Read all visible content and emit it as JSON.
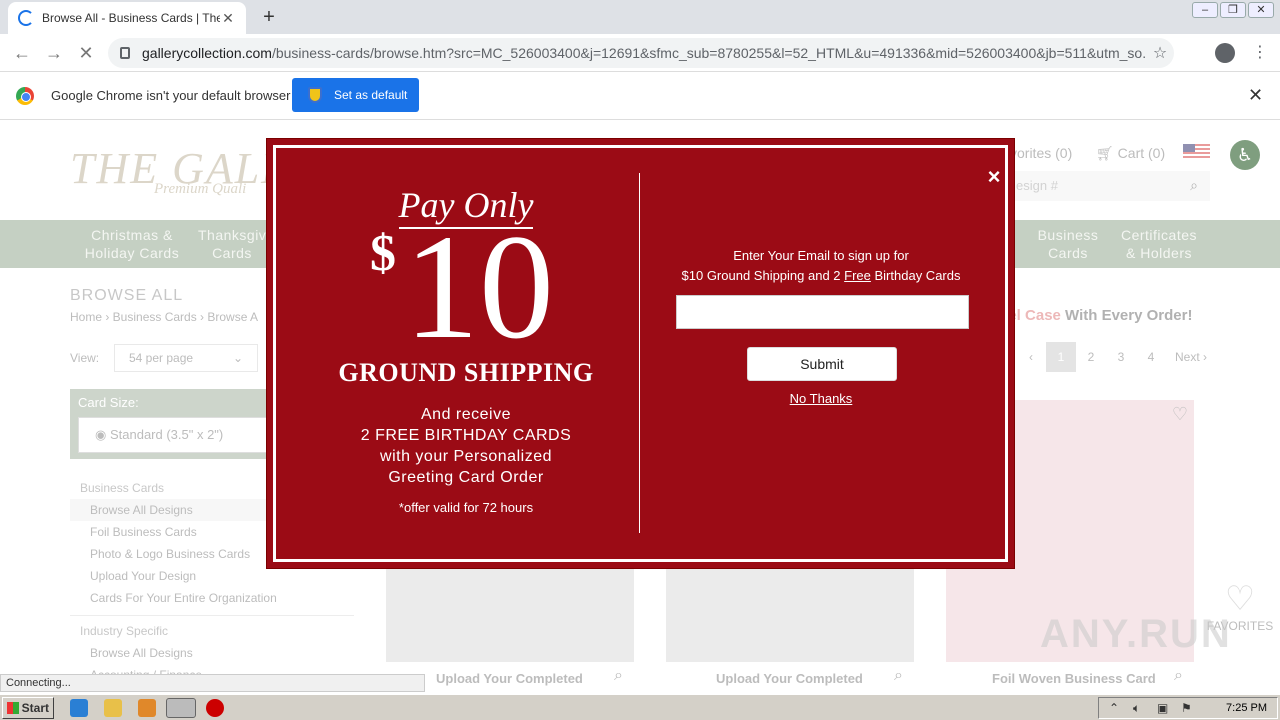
{
  "browser": {
    "tab_title": "Browse All - Business Cards | The Ga",
    "url_host": "gallerycollection.com",
    "url_path": "/business-cards/browse.htm?src=MC_526003400&j=12691&sfmc_sub=8780255&l=52_HTML&u=491336&mid=526003400&jb=511&utm_so...",
    "infobar_message": "Google Chrome isn't your default browser",
    "set_default_label": "Set as default"
  },
  "site": {
    "logo_text": "THE GALL",
    "logo_sub": "Premium Quali",
    "favorites": "vorites (0)",
    "cart": "Cart (0)",
    "search_placeholder": "esign #",
    "nav": [
      {
        "line1": "Christmas &",
        "line2": "Holiday Cards"
      },
      {
        "line1": "Thanksgiv",
        "line2": "Cards"
      },
      {
        "line1": "Business",
        "line2": "Cards"
      },
      {
        "line1": "Certificates",
        "line2": "& Holders"
      }
    ],
    "browse_heading": "BROWSE ALL",
    "breadcrumb": "Home › Business Cards › Browse A",
    "promo_red": "vel Case",
    "promo_rest": " With Every Order!",
    "view_label": "View:",
    "view_value": "54 per page",
    "pager": {
      "prev": "‹",
      "pages": [
        "1",
        "2",
        "3",
        "4"
      ],
      "next": "Next ›"
    },
    "card_size_label": "Card Size:",
    "card_size_value": "Standard (3.5\" x 2\")",
    "sidebar": {
      "group1": "Business Cards",
      "group1_items": [
        "Browse All Designs",
        "Foil Business Cards",
        "Photo & Logo Business Cards",
        "Upload Your Design",
        "Cards For Your Entire Organization"
      ],
      "group2": "Industry Specific",
      "group2_items": [
        "Browse All Designs",
        "Accounting / Finance"
      ]
    },
    "products": [
      {
        "name": "Upload Your Completed"
      },
      {
        "name": "Upload Your Completed"
      },
      {
        "name": "Foil Woven Business Card"
      }
    ],
    "favorites_badge": "FAVORITES"
  },
  "modal": {
    "pay_only": "Pay Only",
    "dollar_sign": "$",
    "amount": "10",
    "ground_shipping": "GROUND SHIPPING",
    "receive_line1": "And receive",
    "receive_line2": "2 FREE BIRTHDAY CARDS",
    "receive_line3": "with your Personalized",
    "receive_line4": "Greeting Card Order",
    "offer_note": "*offer valid for 72 hours",
    "signup_line1": "Enter Your Email to sign up for",
    "signup_line2_pre": "$10 Ground Shipping and 2 ",
    "signup_line2_free": "Free",
    "signup_line2_post": " Birthday Cards",
    "email_value": "",
    "submit_label": "Submit",
    "no_thanks_label": "No Thanks",
    "close_glyph": "×"
  },
  "status": {
    "text": "Connecting..."
  },
  "taskbar": {
    "start_label": "Start",
    "clock": "7:25 PM"
  },
  "watermark": "ANY.RUN"
}
